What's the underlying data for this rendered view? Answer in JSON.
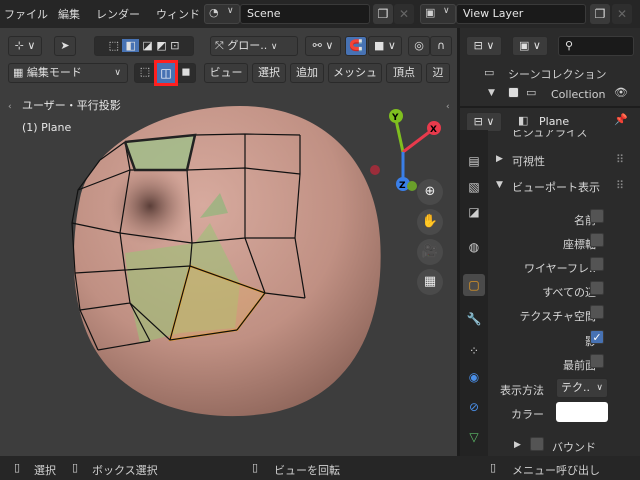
{
  "menu": {
    "file": "ファイル",
    "edit": "編集",
    "render": "レンダー",
    "window": "ウィンド"
  },
  "scene": {
    "name": "Scene"
  },
  "view_layer": {
    "name": "View Layer"
  },
  "viewport": {
    "transform_orientation": "グロー..",
    "mode": "編集モード",
    "menus": [
      "ビュー",
      "選択",
      "追加",
      "メッシュ",
      "頂点",
      "辺"
    ],
    "overlay_title": "ユーザー・平行投影",
    "overlay_object": "(1) Plane",
    "gizmo_axes": [
      "Y",
      "X",
      "Z"
    ]
  },
  "outliner": {
    "scene_collection": "シーンコレクション",
    "collection": "Collection"
  },
  "properties": {
    "object_name": "Plane",
    "section_partial": "ビジュアライズ",
    "visibility": "可視性",
    "viewport_display": "ビューポート表示",
    "rows": [
      {
        "label": "名前",
        "checked": false
      },
      {
        "label": "座標軸",
        "checked": false
      },
      {
        "label": "ワイヤーフレ..",
        "checked": false
      },
      {
        "label": "すべての辺",
        "checked": false
      },
      {
        "label": "テクスチャ空間",
        "checked": false
      },
      {
        "label": "影",
        "checked": true
      },
      {
        "label": "最前面",
        "checked": false
      }
    ],
    "display_as_label": "表示方法",
    "display_as_value": "テク..",
    "color_label": "カラー",
    "color_value": "#ffffff",
    "bounds": "バウンド"
  },
  "status": {
    "select": "選択",
    "box_select": "ボックス選択",
    "rotate_view": "ビューを回転",
    "call_menu": "メニュー呼び出し"
  },
  "colors": {
    "accent_blue": "#4772b3",
    "highlight_red": "#ff2020",
    "sphere": "#c4958a"
  }
}
